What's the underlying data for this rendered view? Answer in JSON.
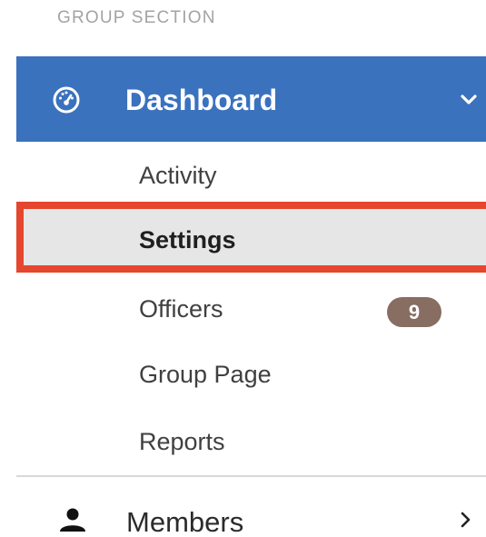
{
  "sidebar": {
    "group_heading": "GROUP SECTION",
    "dashboard": {
      "label": "Dashboard",
      "icon": "dashboard-gauge-icon",
      "expanded": true,
      "accent_color": "#3a72be"
    },
    "sub_items": [
      {
        "label": "Activity",
        "selected": false
      },
      {
        "label": "Settings",
        "selected": true,
        "highlight_color": "#e5462e"
      },
      {
        "label": "Officers",
        "badge": "9",
        "badge_color": "#886d62"
      },
      {
        "label": "Group Page"
      },
      {
        "label": "Reports"
      }
    ],
    "members": {
      "label": "Members",
      "icon": "person-icon",
      "expanded": false
    }
  }
}
